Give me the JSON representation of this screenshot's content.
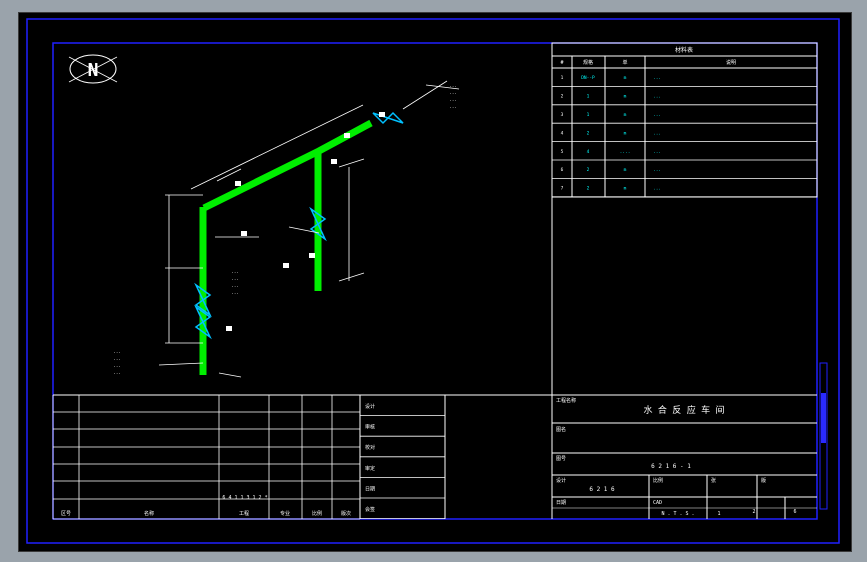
{
  "colors": {
    "background": "#000000",
    "frame": "#2020ff",
    "pipe": "#00ee00",
    "valve": "#00c0ff",
    "text_white": "#ffffff",
    "text_cyan": "#00ffff",
    "text_green": "#3cff3c",
    "viewport_border": "#9aa3ab"
  },
  "drawing": {
    "north_label": "N",
    "project_title": "水 合 反 应 车 间",
    "drawing_number": "6 2 1 6 - 1",
    "drawing_number_short": "6 2 1 6",
    "scale": "N . T . S .",
    "sheet": "1",
    "sheet_total": "2",
    "revision": "6",
    "left_block_code": "6 4 1 1 3 1 2 *",
    "notes_top_right": [
      "...",
      "...",
      "...",
      "..."
    ],
    "notes_mid": [
      "...",
      "...",
      "...",
      "..."
    ],
    "notes_bottom_left": [
      "...",
      "...",
      "...",
      "..."
    ]
  },
  "material_table": {
    "title": "材料表",
    "headers": [
      "#",
      "规格",
      "单",
      "说明"
    ],
    "rows": [
      {
        "no": "1",
        "code": "DN--P",
        "unit": "m",
        "desc": "..."
      },
      {
        "no": "2",
        "code": "1",
        "unit": "m",
        "desc": "..."
      },
      {
        "no": "3",
        "code": "1",
        "unit": "m",
        "desc": "..."
      },
      {
        "no": "4",
        "code": "2",
        "unit": "m",
        "desc": "..."
      },
      {
        "no": "5",
        "code": "4",
        "unit": "....",
        "desc": "..."
      },
      {
        "no": "6",
        "code": "2",
        "unit": "m",
        "desc": "..."
      },
      {
        "no": "7",
        "code": "2",
        "unit": "m",
        "desc": "..."
      }
    ]
  },
  "title_block_left_rows": [
    "设计",
    "审核",
    "校对",
    "审定",
    "日期",
    "会签"
  ],
  "title_block_bottom": [
    "区号",
    "名称",
    "工程",
    "专业",
    "比例",
    "版次"
  ],
  "title_block_right_labels": {
    "project": "工程名称",
    "drawing": "图名",
    "number": "图号",
    "designer": "设计",
    "scale": "比例",
    "sheet": "张",
    "rev": "版",
    "date": "日期",
    "cad": "CAD"
  }
}
